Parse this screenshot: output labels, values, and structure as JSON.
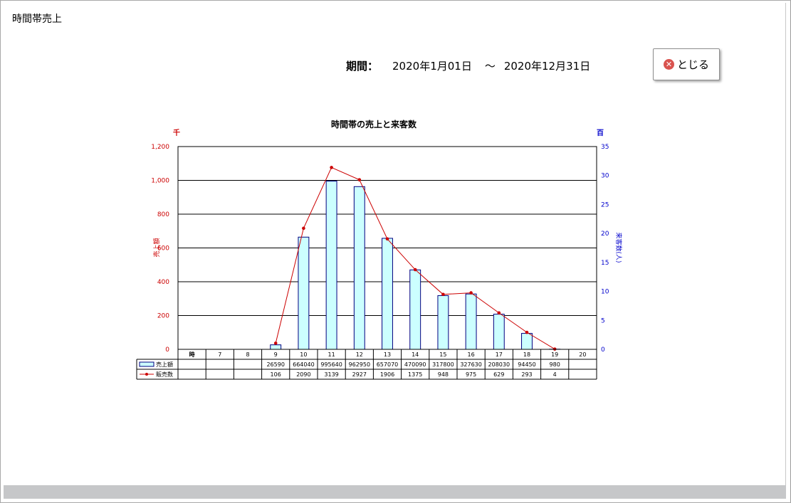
{
  "window": {
    "title": "時間帯売上"
  },
  "period": {
    "label": "期間：",
    "from": "2020年1月01日",
    "separator": "～",
    "to": "2020年12月31日"
  },
  "close_button": {
    "label": "とじる",
    "icon": "close-icon"
  },
  "colors": {
    "bar_fill": "#ccffff",
    "bar_stroke": "#000080",
    "line": "#cc0000",
    "left_axis": "#cc0000",
    "right_axis": "#0000cc"
  },
  "chart_data": {
    "type": "bar+line",
    "title": "時間帯の売上と来客数",
    "left_unit": "千",
    "right_unit": "百",
    "ylabel_left": "売上額",
    "ylabel_right": "来客数(人)",
    "x_header": "時",
    "categories": [
      "7",
      "8",
      "9",
      "10",
      "11",
      "12",
      "13",
      "14",
      "15",
      "16",
      "17",
      "18",
      "19",
      "20"
    ],
    "ylim_left": [
      0,
      1200
    ],
    "ylim_right": [
      0,
      35
    ],
    "left_ticks": [
      "0",
      "200",
      "400",
      "600",
      "800",
      "1,000",
      "1,200"
    ],
    "right_ticks": [
      "0",
      "5",
      "10",
      "15",
      "20",
      "25",
      "30",
      "35"
    ],
    "grid": true,
    "series": [
      {
        "name": "売上額",
        "type": "bar",
        "axis": "left",
        "values": [
          null,
          null,
          26590,
          664040,
          995640,
          962950,
          657070,
          470090,
          317800,
          327630,
          208030,
          94450,
          980,
          null
        ],
        "labels": [
          "",
          "",
          "26590",
          "664040",
          "995640",
          "962950",
          "657070",
          "470090",
          "317800",
          "327630",
          "208030",
          "94450",
          "980",
          ""
        ]
      },
      {
        "name": "販売数",
        "type": "line",
        "axis": "right",
        "values": [
          null,
          null,
          106,
          2090,
          3139,
          2927,
          1906,
          1375,
          948,
          975,
          629,
          293,
          4,
          null
        ],
        "labels": [
          "",
          "",
          "106",
          "2090",
          "3139",
          "2927",
          "1906",
          "1375",
          "948",
          "975",
          "629",
          "293",
          "4",
          ""
        ]
      }
    ]
  }
}
